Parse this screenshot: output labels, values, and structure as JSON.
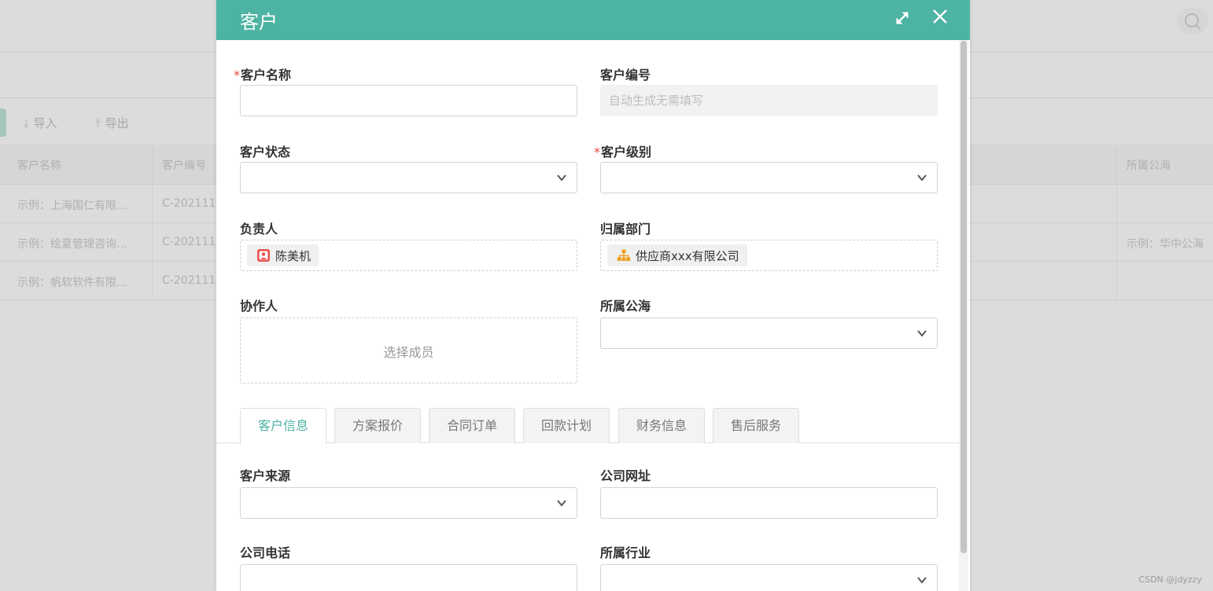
{
  "background": {
    "toolbar": {
      "import_label": "导入",
      "export_label": "导出"
    },
    "table": {
      "columns": [
        "客户名称",
        "客户编号",
        "所属公海"
      ],
      "rows": [
        {
          "name": "示例：上海国仁有限...",
          "code": "C-202111",
          "sea": ""
        },
        {
          "name": "示例：绘夏管理咨询...",
          "code": "C-202111",
          "sea": "示例：华中公海"
        },
        {
          "name": "示例：帆软软件有限...",
          "code": "C-202111",
          "sea": ""
        }
      ]
    },
    "watermark": "CSDN @jdyzzy"
  },
  "modal": {
    "title": "客户",
    "accent_color": "#4db3a2",
    "required_color": "#e74c3c",
    "fields": {
      "customer_name": {
        "label": "客户名称",
        "required": "*",
        "value": ""
      },
      "customer_code": {
        "label": "客户编号",
        "placeholder": "自动生成无需填写"
      },
      "customer_status": {
        "label": "客户状态",
        "value": ""
      },
      "customer_level": {
        "label": "客户级别",
        "required": "*",
        "value": ""
      },
      "owner": {
        "label": "负责人",
        "value": "陈美机",
        "icon": "user-icon"
      },
      "department": {
        "label": "归属部门",
        "value": "供应商xxx有限公司",
        "icon": "org-chart-icon"
      },
      "collaborators": {
        "label": "协作人",
        "placeholder": "选择成员"
      },
      "public_sea": {
        "label": "所属公海",
        "value": ""
      },
      "source": {
        "label": "客户来源",
        "value": ""
      },
      "website": {
        "label": "公司网址",
        "value": ""
      },
      "phone": {
        "label": "公司电话",
        "value": ""
      },
      "industry": {
        "label": "所属行业",
        "value": ""
      }
    },
    "tabs": [
      {
        "label": "客户信息",
        "active": true
      },
      {
        "label": "方案报价"
      },
      {
        "label": "合同订单"
      },
      {
        "label": "回款计划"
      },
      {
        "label": "财务信息"
      },
      {
        "label": "售后服务"
      }
    ]
  }
}
